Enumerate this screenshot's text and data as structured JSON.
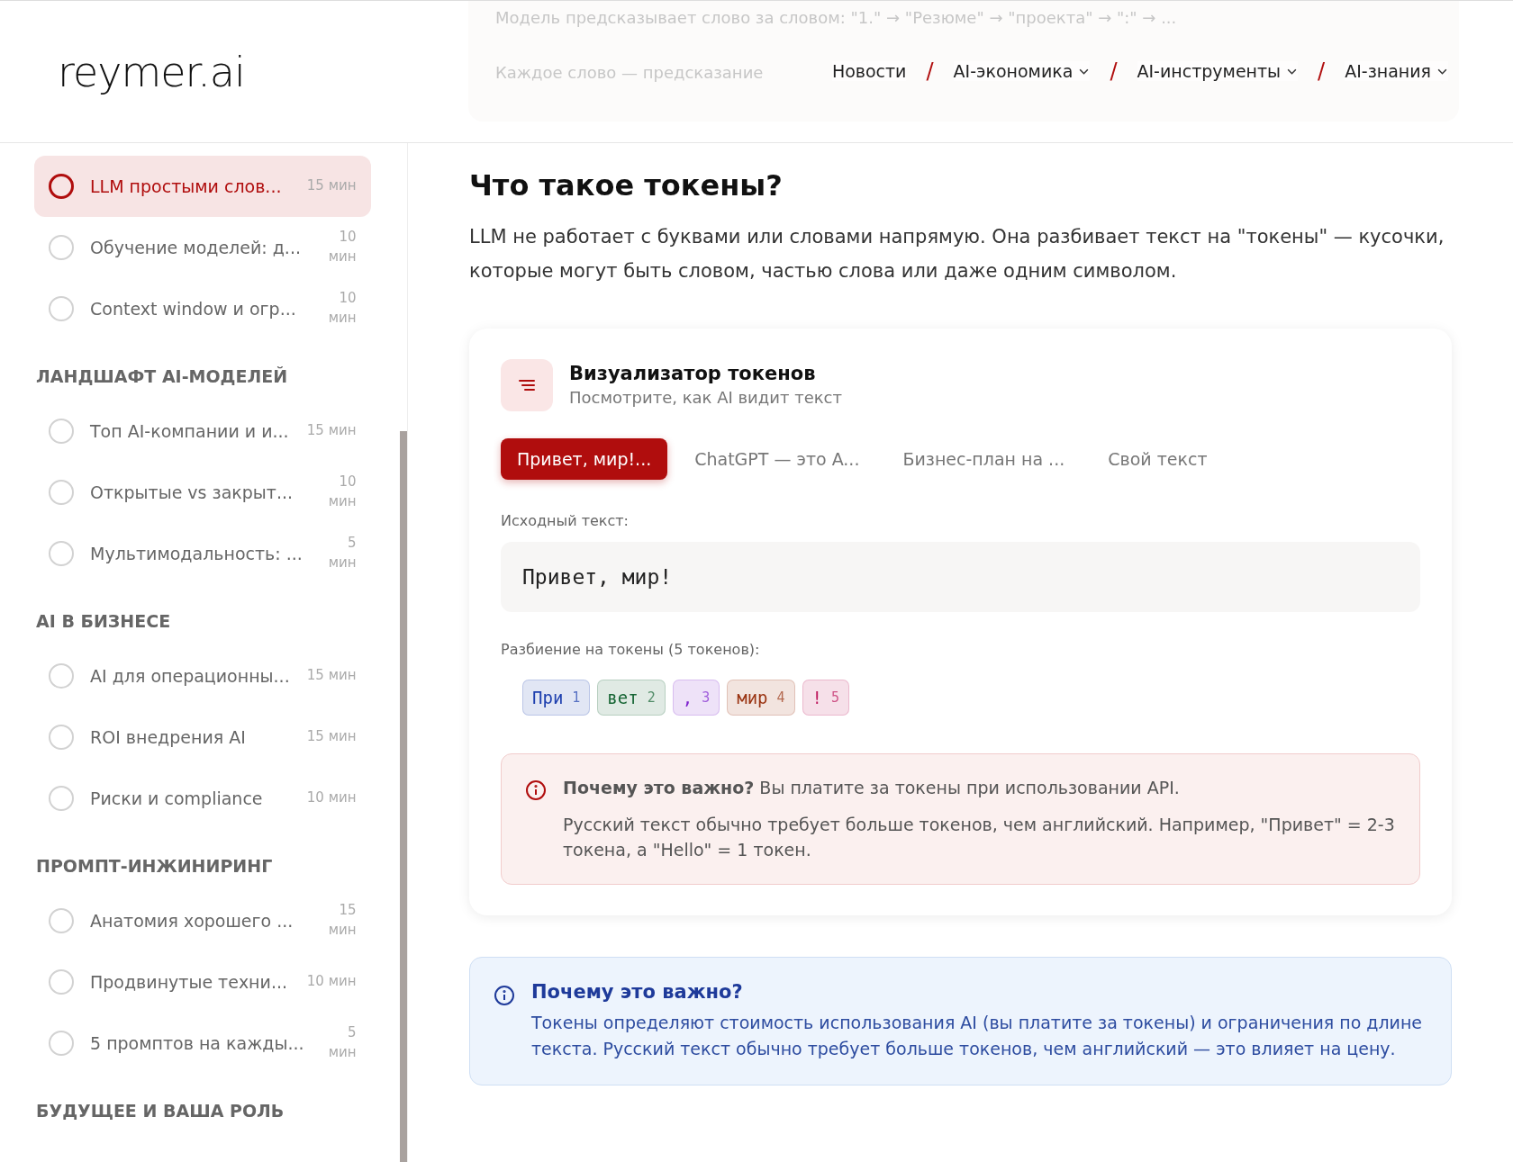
{
  "header": {
    "logo": "reymer.ai",
    "backdrop": [
      "Модель предсказывает слово за словом: \"1.\" → \"Резюме\" → \"проекта\" → \":\" → ...",
      "Каждое слово — предсказание"
    ],
    "nav": [
      {
        "label": "Новости",
        "dropdown": false
      },
      {
        "separator": "/",
        "label": "AI-экономика",
        "dropdown": true
      },
      {
        "separator": "/",
        "label": "AI-инструменты",
        "dropdown": true
      },
      {
        "separator": "/",
        "label": "AI-знания",
        "dropdown": true
      }
    ]
  },
  "sidebar": {
    "groups": [
      {
        "lessons": [
          {
            "title": "LLM простыми слов...",
            "time": "15 мин",
            "selected": true
          },
          {
            "title": "Обучение моделей: д...",
            "time": "10 мин",
            "selected": false
          },
          {
            "title": "Context window и огр...",
            "time": "10 мин",
            "selected": false
          }
        ]
      },
      {
        "title": "ЛАНДШАФТ AI-МОДЕЛЕЙ",
        "lessons": [
          {
            "title": "Топ AI-компании и и...",
            "time": "15 мин",
            "selected": false
          },
          {
            "title": "Открытые vs закрыт...",
            "time": "10 мин",
            "selected": false
          },
          {
            "title": "Мультимодальность: ...",
            "time": "5 мин",
            "selected": false
          }
        ]
      },
      {
        "title": "AI В БИЗНЕСЕ",
        "lessons": [
          {
            "title": "AI для операционны...",
            "time": "15 мин",
            "selected": false
          },
          {
            "title": "ROI внедрения AI",
            "time": "15 мин",
            "selected": false
          },
          {
            "title": "Риски и compliance",
            "time": "10 мин",
            "selected": false
          }
        ]
      },
      {
        "title": "ПРОМПТ-ИНЖИНИРИНГ",
        "lessons": [
          {
            "title": "Анатомия хорошего ...",
            "time": "15 мин",
            "selected": false
          },
          {
            "title": "Продвинутые техни...",
            "time": "10 мин",
            "selected": false
          },
          {
            "title": "5 промптов на кажды...",
            "time": "5 мин",
            "selected": false
          }
        ]
      },
      {
        "title": "БУДУЩЕЕ И ВАША РОЛЬ"
      }
    ]
  },
  "article": {
    "heading": "Что такое токены?",
    "intro": "LLM не работает с буквами или словами напрямую. Она разбивает текст на \"токены\" — кусочки, которые могут быть словом, частью слова или даже одним символом.",
    "visualizer": {
      "title": "Визуализатор токенов",
      "subtitle": "Посмотрите, как AI видит текст",
      "tabs": [
        {
          "label": "Привет, мир!...",
          "selected": true
        },
        {
          "label": "ChatGPT — это A...",
          "selected": false
        },
        {
          "label": "Бизнес-план на ...",
          "selected": false
        },
        {
          "label": "Свой текст",
          "selected": false
        }
      ],
      "source_label": "Исходный текст:",
      "source_text": "Привет, мир!",
      "tokens_label": "Разбиение на токены (5 токенов):",
      "tokens": [
        {
          "text": "При",
          "index": "1",
          "color": "#1e40af"
        },
        {
          "text": "вет",
          "index": "2",
          "color": "#166534"
        },
        {
          "text": ",",
          "index": "3",
          "color": "#7e22ce"
        },
        {
          "text": "мир",
          "index": "4",
          "color": "#9a3412"
        },
        {
          "text": "!",
          "index": "5",
          "color": "#be185d"
        }
      ],
      "note": {
        "lead": "**Почему это важно?** Вы платите за токены при использовании API.",
        "body": "Русский текст обычно требует больше токенов, чем английский. Например, \"Привет\" = 2-3 токена, а \"Hello\" = 1 токен."
      }
    },
    "callout": {
      "title": "Почему это важно?",
      "body": "Токены определяют стоимость использования AI (вы платите за токены) и ограничения по длине текста. Русский текст обычно требует больше токенов, чем английский — это влияет на цену."
    }
  }
}
